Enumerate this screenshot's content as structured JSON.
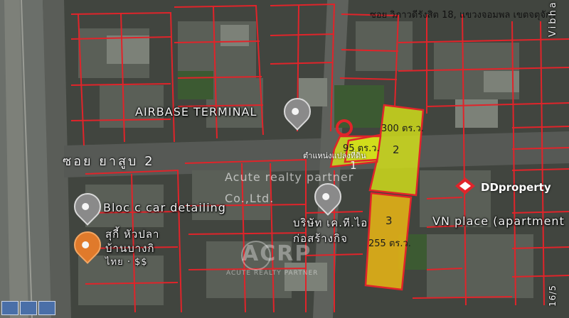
{
  "caption": "ซอย วิภาวดีรังสิต 18, แขวงจอมพล เขตจตุจักร",
  "poi": {
    "airbase": "AIRBASE TERMINAL",
    "bloc": "Bloc c car detailing",
    "vn_place": "VN place (apartment",
    "restaurant_line1": "สุกี้ หัวปลา",
    "restaurant_line2": "บ้านบางกิ",
    "restaurant_line3": "ไทย · $$",
    "company_line1": "บริษัท เค.ที.ไอ",
    "company_line2": "ก่อสร้างกิจ"
  },
  "streets": {
    "soi": "ซอย ยาสูบ 2",
    "vibha": "Vibha",
    "number": "16/5"
  },
  "parcels": {
    "p1_area": "95 ตร.ว.",
    "p1_num": "1",
    "p2_area": "300 ตร.ว.",
    "p2_num": "2",
    "p3_area": "255 ตร.ว.",
    "p3_num": "3",
    "position_label": "ตำแหน่งแปลงที่ดิน"
  },
  "watermark": {
    "company": "Acute realty partner",
    "company2": "Co.,Ltd.",
    "logo": "ACRP",
    "logo_sub": "ACUTE REALTY PARTNER"
  },
  "brand": "DDproperty",
  "colors": {
    "parcel_yellow": "#d6e21a",
    "parcel_orange": "#e6b416",
    "boundary_red": "#e0242a",
    "marker_red": "#e0242a"
  }
}
